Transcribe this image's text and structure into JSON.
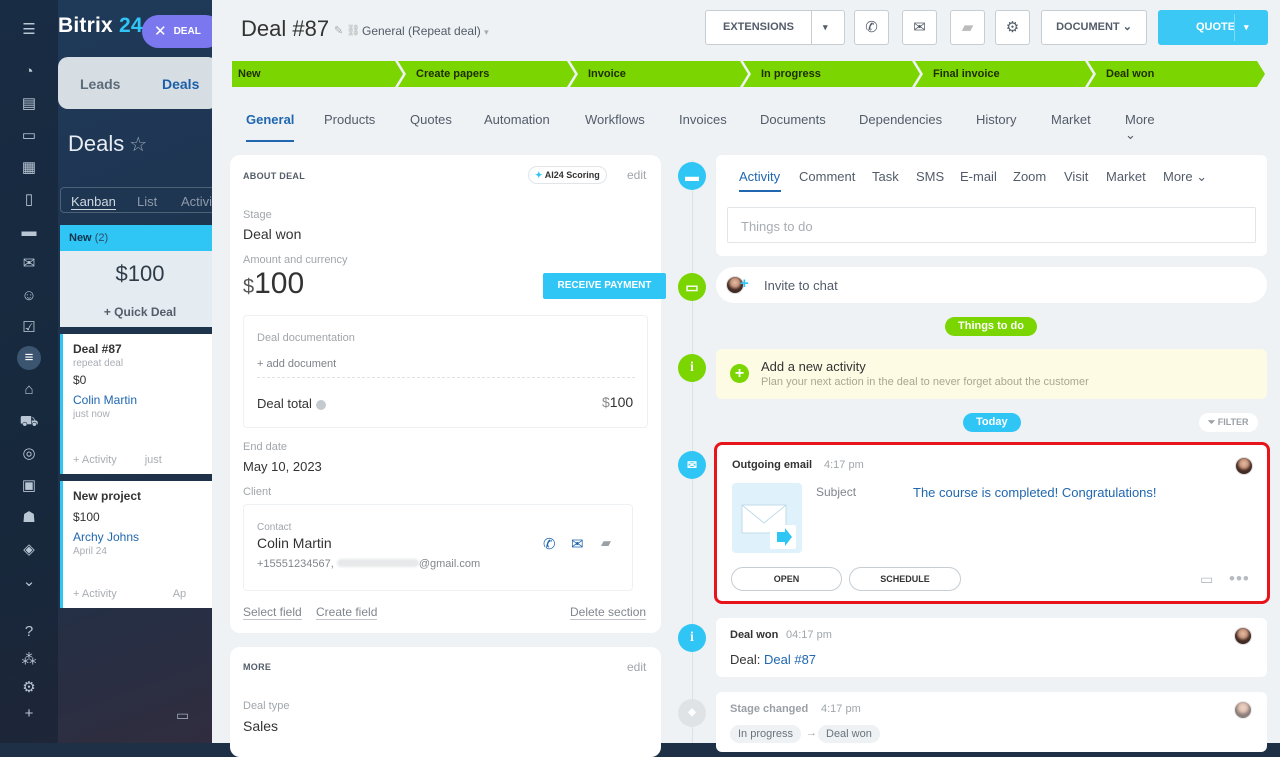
{
  "brand": {
    "name": "Bitrix",
    "num": "24",
    "pill": "DEAL"
  },
  "bgpage": {
    "tabs": [
      "Leads",
      "Deals"
    ],
    "title": "Deals",
    "views": [
      "Kanban",
      "List",
      "Activi"
    ],
    "column": {
      "name": "New",
      "count": "(2)",
      "sum": "$100",
      "quick": "+ Quick Deal"
    },
    "cards": [
      {
        "title": "Deal #87",
        "sub": "repeat deal",
        "amount": "$0",
        "contact": "Colin Martin",
        "time": "just now",
        "foot": "+ Activity",
        "foot2": "just"
      },
      {
        "title": "New project",
        "sub": "",
        "amount": "$100",
        "contact": "Archy Johns",
        "time": "April 24",
        "foot": "+ Activity",
        "foot2": "Ap"
      }
    ]
  },
  "header": {
    "title": "Deal #87",
    "category": "General (Repeat deal)",
    "extensions": "EXTENSIONS",
    "document": "DOCUMENT",
    "quote": "QUOTE"
  },
  "stages": [
    "New",
    "Create papers",
    "Invoice",
    "In progress",
    "Final invoice",
    "Deal won"
  ],
  "tabs": [
    "General",
    "Products",
    "Quotes",
    "Automation",
    "Workflows",
    "Invoices",
    "Documents",
    "Dependencies",
    "History",
    "Market",
    "More"
  ],
  "about": {
    "heading": "ABOUT DEAL",
    "ai": "AI24 Scoring",
    "edit": "edit",
    "stage_label": "Stage",
    "stage": "Deal won",
    "amount_label": "Amount and currency",
    "currency": "$",
    "amount": "100",
    "receive": "RECEIVE PAYMENT",
    "doc_label": "Deal documentation",
    "add_doc": "+ add document",
    "total_label": "Deal total",
    "total_cur": "$",
    "total": "100",
    "end_label": "End date",
    "end": "May 10, 2023",
    "client_label": "Client",
    "contact_label": "Contact",
    "contact": "Colin Martin",
    "phone": "+15551234567,",
    "email_suffix": "@gmail.com",
    "select_field": "Select field",
    "create_field": "Create field",
    "delete_section": "Delete section"
  },
  "more": {
    "heading": "MORE",
    "edit": "edit",
    "type_label": "Deal type",
    "type": "Sales"
  },
  "activity": {
    "tabs": [
      "Activity",
      "Comment",
      "Task",
      "SMS",
      "E-mail",
      "Zoom",
      "Visit",
      "Market",
      "More"
    ],
    "placeholder": "Things to do",
    "invite": "Invite to chat",
    "todo_badge": "Things to do",
    "add_title": "Add a new activity",
    "add_sub": "Plan your next action in the deal to never forget about the customer",
    "today": "Today",
    "filter": "FILTER"
  },
  "email": {
    "title": "Outgoing email",
    "time": "4:17 pm",
    "subject_label": "Subject",
    "subject": "The course is completed! Congratulations!",
    "open": "OPEN",
    "schedule": "SCHEDULE"
  },
  "won": {
    "title": "Deal won",
    "time": "04:17 pm",
    "deal_label": "Deal:",
    "deal_link": "Deal #87"
  },
  "stagechg": {
    "title": "Stage changed",
    "time": "4:17 pm",
    "from": "In progress",
    "arrow": "→",
    "to": "Deal won"
  },
  "colors": {
    "accent": "#2fc6f6",
    "stage": "#7bd500",
    "highlight": "#e8141b"
  }
}
